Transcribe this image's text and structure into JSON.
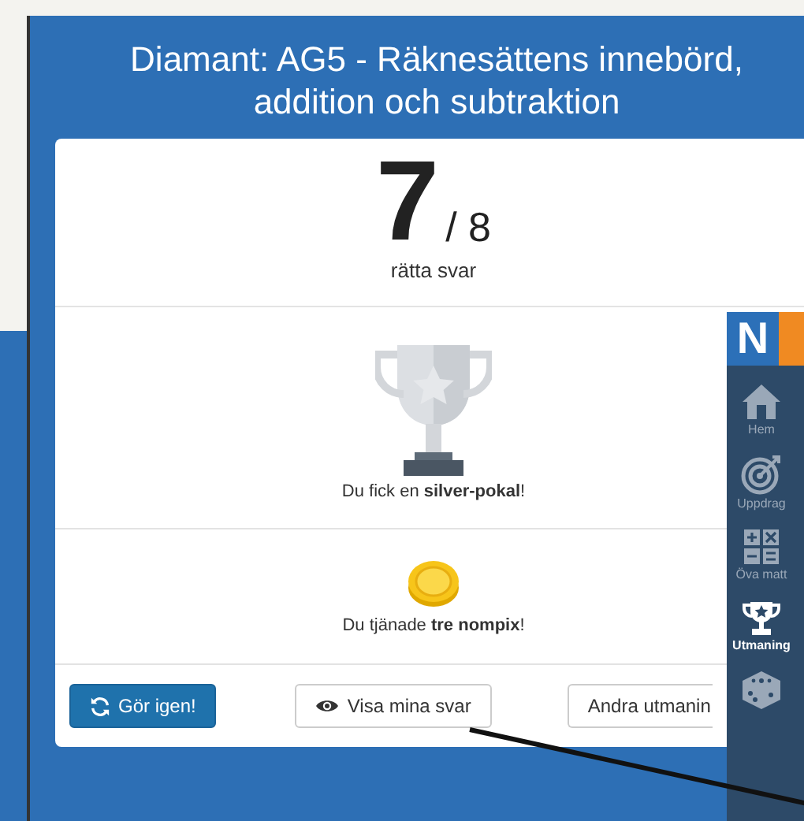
{
  "dialog": {
    "title": "Diamant: AG5 - Räknesättens innebörd, addition och subtraktion",
    "score": {
      "correct": "7",
      "total": "/ 8",
      "caption": "rätta svar"
    },
    "trophy": {
      "message": "Du fick en **silver-pokal**!"
    },
    "reward": {
      "message": "Du tjänade **tre nompix**!"
    },
    "buttons": [
      {
        "label": "Gör igen!",
        "kind": "primary"
      },
      {
        "label": "Visa mina svar",
        "kind": "view"
      },
      {
        "label": "Andra utmanin",
        "kind": "plain"
      }
    ]
  },
  "sidebar": {
    "logo": "N",
    "items": [
      {
        "label": "Hem",
        "kind": "home",
        "selected": false
      },
      {
        "label": "Uppdrag",
        "kind": "target",
        "selected": false
      },
      {
        "label": "Öva matt",
        "kind": "calc",
        "selected": false
      },
      {
        "label": "Utmaning",
        "kind": "trophy",
        "selected": true
      },
      {
        "kind": "dice",
        "selected": false
      }
    ]
  }
}
